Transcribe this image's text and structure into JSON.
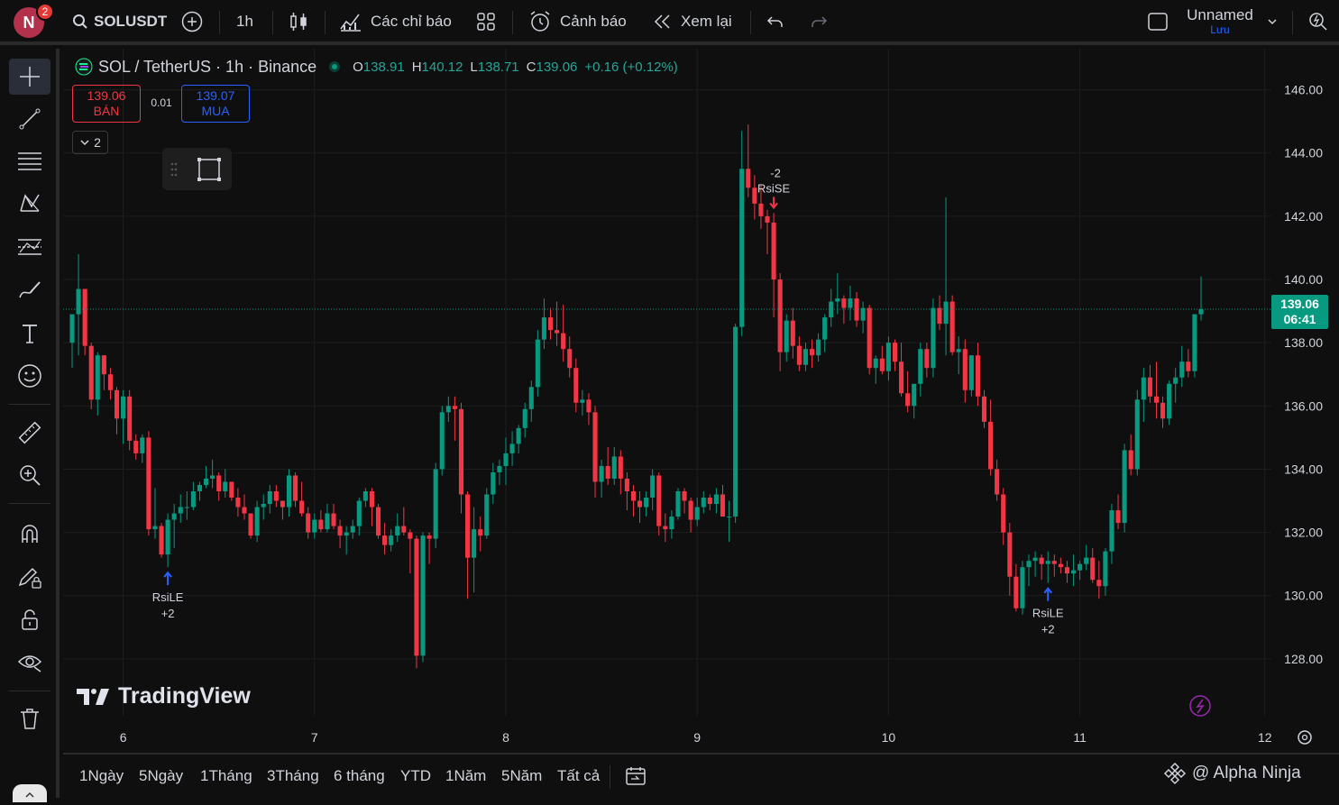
{
  "topbar": {
    "avatar_letter": "N",
    "notif_count": "2",
    "symbol": "SOLUSDT",
    "interval": "1h",
    "indicators_label": "Các chỉ báo",
    "alert_label": "Cảnh báo",
    "replay_label": "Xem lại",
    "layout_name": "Unnamed",
    "save_label": "Lưu"
  },
  "legend": {
    "title": "SOL / TetherUS · 1h · Binance",
    "o_label": "O",
    "o": "138.91",
    "h_label": "H",
    "h": "140.12",
    "l_label": "L",
    "l": "138.71",
    "c_label": "C",
    "c": "139.06",
    "change": "+0.16 (+0.12%)"
  },
  "trade": {
    "sell_price": "139.06",
    "sell_label": "BÁN",
    "spread": "0.01",
    "buy_price": "139.07",
    "buy_label": "MUA"
  },
  "indicator_collapse": "2",
  "price_tag": {
    "price": "139.06",
    "countdown": "06:41"
  },
  "chart_data": {
    "type": "candlestick",
    "symbol": "SOL / TetherUS",
    "interval": "1h",
    "exchange": "Binance",
    "y_ticks": [
      "146.00",
      "144.00",
      "142.00",
      "140.00",
      "138.00",
      "136.00",
      "134.00",
      "132.00",
      "130.00",
      "128.00"
    ],
    "ylim": [
      126.2,
      147.3
    ],
    "x_ticks": [
      "6",
      "7",
      "8",
      "9",
      "10",
      "11",
      "12"
    ],
    "current_price": 139.06,
    "ohlc": [
      [
        138.0,
        138.9,
        137.2,
        138.9
      ],
      [
        138.9,
        140.8,
        137.6,
        139.7
      ],
      [
        139.7,
        139.7,
        137.6,
        137.9
      ],
      [
        137.9,
        138.0,
        135.9,
        136.2
      ],
      [
        136.2,
        137.7,
        135.7,
        137.6
      ],
      [
        137.6,
        137.6,
        136.5,
        137.0
      ],
      [
        137.0,
        137.2,
        136.2,
        136.5
      ],
      [
        136.5,
        136.6,
        135.1,
        135.6
      ],
      [
        135.6,
        136.5,
        134.8,
        136.3
      ],
      [
        136.3,
        136.5,
        134.6,
        134.9
      ],
      [
        134.9,
        135.1,
        134.3,
        134.5
      ],
      [
        134.5,
        135.1,
        134.2,
        135.0
      ],
      [
        135.0,
        135.2,
        131.9,
        132.1
      ],
      [
        132.1,
        133.4,
        131.8,
        132.2
      ],
      [
        132.2,
        132.3,
        131.2,
        131.3
      ],
      [
        131.3,
        132.6,
        130.9,
        132.4
      ],
      [
        132.4,
        132.9,
        131.5,
        132.6
      ],
      [
        132.6,
        133.2,
        132.3,
        132.8
      ],
      [
        132.8,
        133.3,
        132.4,
        132.8
      ],
      [
        132.8,
        133.6,
        132.7,
        133.3
      ],
      [
        133.3,
        133.6,
        133.0,
        133.5
      ],
      [
        133.5,
        134.1,
        133.4,
        133.7
      ],
      [
        133.7,
        134.3,
        133.4,
        133.8
      ],
      [
        133.8,
        133.9,
        133.0,
        133.3
      ],
      [
        133.3,
        134.0,
        133.1,
        133.6
      ],
      [
        133.6,
        133.6,
        133.0,
        133.1
      ],
      [
        133.1,
        133.4,
        132.5,
        132.8
      ],
      [
        132.8,
        133.2,
        132.4,
        132.6
      ],
      [
        132.6,
        132.6,
        131.8,
        131.9
      ],
      [
        131.9,
        133.0,
        131.7,
        132.8
      ],
      [
        132.8,
        133.2,
        132.4,
        132.9
      ],
      [
        132.9,
        133.5,
        132.6,
        133.3
      ],
      [
        133.3,
        133.5,
        132.8,
        133.0
      ],
      [
        133.0,
        133.0,
        132.4,
        132.8
      ],
      [
        132.8,
        134.0,
        132.5,
        133.8
      ],
      [
        133.8,
        133.9,
        132.8,
        133.0
      ],
      [
        133.0,
        133.6,
        132.5,
        132.6
      ],
      [
        132.6,
        132.8,
        131.8,
        132.0
      ],
      [
        132.0,
        132.6,
        131.8,
        132.4
      ],
      [
        132.4,
        132.7,
        132.0,
        132.1
      ],
      [
        132.1,
        132.9,
        132.0,
        132.6
      ],
      [
        132.6,
        132.9,
        132.1,
        132.2
      ],
      [
        132.2,
        132.4,
        131.5,
        131.9
      ],
      [
        131.9,
        132.2,
        131.3,
        132.0
      ],
      [
        132.0,
        132.4,
        131.8,
        132.2
      ],
      [
        132.2,
        133.1,
        131.9,
        133.0
      ],
      [
        133.0,
        133.4,
        132.8,
        133.3
      ],
      [
        133.3,
        133.4,
        132.2,
        132.8
      ],
      [
        132.8,
        132.9,
        131.8,
        131.9
      ],
      [
        131.9,
        132.3,
        131.3,
        131.6
      ],
      [
        131.6,
        132.1,
        131.4,
        131.9
      ],
      [
        131.9,
        132.6,
        131.7,
        132.2
      ],
      [
        132.2,
        132.8,
        131.9,
        132.0
      ],
      [
        132.0,
        132.1,
        130.7,
        131.8
      ],
      [
        131.8,
        131.9,
        127.7,
        128.1
      ],
      [
        128.1,
        132.0,
        127.9,
        131.9
      ],
      [
        131.9,
        132.0,
        131.0,
        131.8
      ],
      [
        131.8,
        134.2,
        131.5,
        134.0
      ],
      [
        134.0,
        136.0,
        133.8,
        135.8
      ],
      [
        135.8,
        136.3,
        135.5,
        136.0
      ],
      [
        136.0,
        136.3,
        134.9,
        135.9
      ],
      [
        135.9,
        136.1,
        132.6,
        133.2
      ],
      [
        133.2,
        133.3,
        129.9,
        131.2
      ],
      [
        131.2,
        132.8,
        130.1,
        132.1
      ],
      [
        132.1,
        132.5,
        131.4,
        131.9
      ],
      [
        131.9,
        133.4,
        131.8,
        133.2
      ],
      [
        133.2,
        134.2,
        132.9,
        133.9
      ],
      [
        133.9,
        134.3,
        133.5,
        134.1
      ],
      [
        134.1,
        135.0,
        133.5,
        134.5
      ],
      [
        134.5,
        135.2,
        134.1,
        134.8
      ],
      [
        134.8,
        135.4,
        134.5,
        135.3
      ],
      [
        135.3,
        136.1,
        135.0,
        135.9
      ],
      [
        135.9,
        136.8,
        135.5,
        136.6
      ],
      [
        136.6,
        138.4,
        136.3,
        138.1
      ],
      [
        138.1,
        139.4,
        137.8,
        138.8
      ],
      [
        138.8,
        139.1,
        138.1,
        138.4
      ],
      [
        138.4,
        139.3,
        137.9,
        138.3
      ],
      [
        138.3,
        139.2,
        137.4,
        137.8
      ],
      [
        137.8,
        138.2,
        136.9,
        137.2
      ],
      [
        137.2,
        137.5,
        135.8,
        136.1
      ],
      [
        136.1,
        136.5,
        135.7,
        136.2
      ],
      [
        136.2,
        136.4,
        135.4,
        135.8
      ],
      [
        135.8,
        136.0,
        133.1,
        133.6
      ],
      [
        133.6,
        134.3,
        133.1,
        134.1
      ],
      [
        134.1,
        134.7,
        133.5,
        133.7
      ],
      [
        133.7,
        134.7,
        133.5,
        134.4
      ],
      [
        134.4,
        134.6,
        133.2,
        133.7
      ],
      [
        133.7,
        133.9,
        132.7,
        133.3
      ],
      [
        133.3,
        133.5,
        132.5,
        133.0
      ],
      [
        133.0,
        133.3,
        132.3,
        132.8
      ],
      [
        132.8,
        133.3,
        132.5,
        133.1
      ],
      [
        133.1,
        134.0,
        132.7,
        133.8
      ],
      [
        133.8,
        133.9,
        131.9,
        132.2
      ],
      [
        132.2,
        132.6,
        131.7,
        132.1
      ],
      [
        132.1,
        132.7,
        131.8,
        132.5
      ],
      [
        132.5,
        133.4,
        132.4,
        133.3
      ],
      [
        133.3,
        133.4,
        132.6,
        133.0
      ],
      [
        133.0,
        133.1,
        132.0,
        132.4
      ],
      [
        132.4,
        133.1,
        132.2,
        132.8
      ],
      [
        132.8,
        133.3,
        132.6,
        133.1
      ],
      [
        133.1,
        133.2,
        132.7,
        132.9
      ],
      [
        132.9,
        133.4,
        132.6,
        133.2
      ],
      [
        133.2,
        133.5,
        132.5,
        132.5
      ],
      [
        132.5,
        133.0,
        131.7,
        132.5
      ],
      [
        132.5,
        138.6,
        132.3,
        138.5
      ],
      [
        138.5,
        144.7,
        138.2,
        143.5
      ],
      [
        143.5,
        144.9,
        142.6,
        142.9
      ],
      [
        142.9,
        143.3,
        141.9,
        142.4
      ],
      [
        142.4,
        143.0,
        141.6,
        142.0
      ],
      [
        142.0,
        142.2,
        140.8,
        141.8
      ],
      [
        141.8,
        142.1,
        138.8,
        140.0
      ],
      [
        140.0,
        140.2,
        137.1,
        137.7
      ],
      [
        137.7,
        138.9,
        137.4,
        138.7
      ],
      [
        138.7,
        139.1,
        137.5,
        137.9
      ],
      [
        137.9,
        138.2,
        137.1,
        137.3
      ],
      [
        137.3,
        138.0,
        137.1,
        137.8
      ],
      [
        137.8,
        138.1,
        137.2,
        137.6
      ],
      [
        137.6,
        138.3,
        137.4,
        138.1
      ],
      [
        138.1,
        138.9,
        137.7,
        138.8
      ],
      [
        138.8,
        139.7,
        138.5,
        139.3
      ],
      [
        139.3,
        140.2,
        138.9,
        139.4
      ],
      [
        139.4,
        139.5,
        138.6,
        139.1
      ],
      [
        139.1,
        139.8,
        138.7,
        139.4
      ],
      [
        139.4,
        139.6,
        138.5,
        138.7
      ],
      [
        138.7,
        139.3,
        138.3,
        139.1
      ],
      [
        139.1,
        139.2,
        137.0,
        137.2
      ],
      [
        137.2,
        137.6,
        136.7,
        137.5
      ],
      [
        137.5,
        137.9,
        137.0,
        137.1
      ],
      [
        137.1,
        138.2,
        136.8,
        138.0
      ],
      [
        138.0,
        138.1,
        137.1,
        137.4
      ],
      [
        137.4,
        138.0,
        136.3,
        136.4
      ],
      [
        136.4,
        137.1,
        135.8,
        136.0
      ],
      [
        136.0,
        136.6,
        135.6,
        136.7
      ],
      [
        136.7,
        138.0,
        136.3,
        137.8
      ],
      [
        137.8,
        138.0,
        136.9,
        137.2
      ],
      [
        137.2,
        139.4,
        136.9,
        139.1
      ],
      [
        139.1,
        139.5,
        138.4,
        138.6
      ],
      [
        138.6,
        142.6,
        137.6,
        139.3
      ],
      [
        139.3,
        139.5,
        137.6,
        137.7
      ],
      [
        137.7,
        138.2,
        137.0,
        137.8
      ],
      [
        137.8,
        138.1,
        136.1,
        136.5
      ],
      [
        136.5,
        137.6,
        136.3,
        137.6
      ],
      [
        137.6,
        138.0,
        136.0,
        136.3
      ],
      [
        136.3,
        136.5,
        135.3,
        135.5
      ],
      [
        135.5,
        136.2,
        133.8,
        134.0
      ],
      [
        134.0,
        134.3,
        133.0,
        133.2
      ],
      [
        133.2,
        133.4,
        131.6,
        132.0
      ],
      [
        132.0,
        132.3,
        130.0,
        130.6
      ],
      [
        130.6,
        131.0,
        129.5,
        129.6
      ],
      [
        129.6,
        131.1,
        129.4,
        130.9
      ],
      [
        130.9,
        131.3,
        130.3,
        131.1
      ],
      [
        131.1,
        131.4,
        130.6,
        131.2
      ],
      [
        131.2,
        131.3,
        130.5,
        131.0
      ],
      [
        131.0,
        131.4,
        130.4,
        131.1
      ],
      [
        131.1,
        131.3,
        130.6,
        131.0
      ],
      [
        131.0,
        131.2,
        130.7,
        130.9
      ],
      [
        130.9,
        131.1,
        130.4,
        130.7
      ],
      [
        130.7,
        131.3,
        130.3,
        130.8
      ],
      [
        130.8,
        131.1,
        130.5,
        131.0
      ],
      [
        131.0,
        131.6,
        130.8,
        131.2
      ],
      [
        131.2,
        131.5,
        130.4,
        130.5
      ],
      [
        130.5,
        131.1,
        129.9,
        130.3
      ],
      [
        130.3,
        131.5,
        130.0,
        131.4
      ],
      [
        131.4,
        132.9,
        131.0,
        132.7
      ],
      [
        132.7,
        133.2,
        132.1,
        132.3
      ],
      [
        132.3,
        134.8,
        132.0,
        134.6
      ],
      [
        134.6,
        135.1,
        133.8,
        134.0
      ],
      [
        134.0,
        136.5,
        133.8,
        136.2
      ],
      [
        136.2,
        137.2,
        135.5,
        136.9
      ],
      [
        136.9,
        137.3,
        136.1,
        136.3
      ],
      [
        136.3,
        137.4,
        135.6,
        136.1
      ],
      [
        136.1,
        136.3,
        135.3,
        135.6
      ],
      [
        135.6,
        136.8,
        135.4,
        136.7
      ],
      [
        136.7,
        137.2,
        136.1,
        136.9
      ],
      [
        136.9,
        137.9,
        136.6,
        137.4
      ],
      [
        137.4,
        137.8,
        136.9,
        137.1
      ],
      [
        137.1,
        138.9,
        136.9,
        138.9
      ],
      [
        138.9,
        140.1,
        138.7,
        139.06
      ]
    ],
    "signals": [
      {
        "label": "RsiLE",
        "qty": "+2",
        "type": "entry-long"
      },
      {
        "label": "RsiSE",
        "qty": "-2",
        "type": "entry-short"
      },
      {
        "label": "RsiLE",
        "qty": "+2",
        "type": "entry-long"
      }
    ],
    "colors": {
      "up": "#089981",
      "down": "#f23645"
    }
  },
  "branding": {
    "logo_text": "TradingView"
  },
  "bottombar": {
    "ranges": [
      "1Ngày",
      "5Ngày",
      "1Tháng",
      "3Tháng",
      "6 tháng",
      "YTD",
      "1Năm",
      "5Năm",
      "Tất cả"
    ],
    "watermark": "@ Alpha Ninja"
  }
}
